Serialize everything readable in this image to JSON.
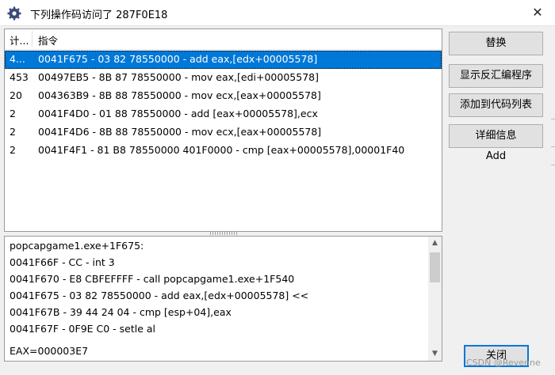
{
  "window": {
    "title": "下列操作码访问了 287F0E18",
    "close_glyph": "✕",
    "icon": "gear-app-icon"
  },
  "list": {
    "columns": {
      "count": "计...",
      "instruction": "指令"
    },
    "rows": [
      {
        "count": "4...",
        "instruction": "0041F675 - 03 82 78550000  - add eax,[edx+00005578]",
        "selected": true
      },
      {
        "count": "453",
        "instruction": "00497EB5 - 8B 87 78550000  - mov eax,[edi+00005578]",
        "selected": false
      },
      {
        "count": "20",
        "instruction": "004363B9 - 8B 88 78550000  - mov ecx,[eax+00005578]",
        "selected": false
      },
      {
        "count": "2",
        "instruction": "0041F4D0 - 01 88 78550000  - add [eax+00005578],ecx",
        "selected": false
      },
      {
        "count": "2",
        "instruction": "0041F4D6 - 8B 88 78550000  - mov ecx,[eax+00005578]",
        "selected": false
      },
      {
        "count": "2",
        "instruction": "0041F4F1 - 81 B8 78550000 401F0000 - cmp [eax+00005578],00001F40",
        "selected": false
      }
    ]
  },
  "detail": {
    "lines": [
      "popcapgame1.exe+1F675:",
      "0041F66F - CC - int 3",
      "0041F670 - E8 CBFEFFFF - call popcapgame1.exe+1F540",
      "0041F675 - 03 82 78550000  - add eax,[edx+00005578] <<",
      "0041F67B - 39 44 24 04  - cmp [esp+04],eax",
      "0041F67F - 0F9E C0  - setle al",
      "",
      "EAX=000003E7"
    ]
  },
  "buttons": {
    "replace": "替换",
    "disassemble": "显示反汇编程序",
    "add_to_list": "添加到代码列表",
    "details": "详细信息",
    "add_label": "Add",
    "close": "关闭"
  },
  "watermark": "CSDN @Revenne",
  "colors": {
    "selection": "#0078d7",
    "button_face": "#e1e1e1",
    "window_bg": "#f0f0f0"
  }
}
